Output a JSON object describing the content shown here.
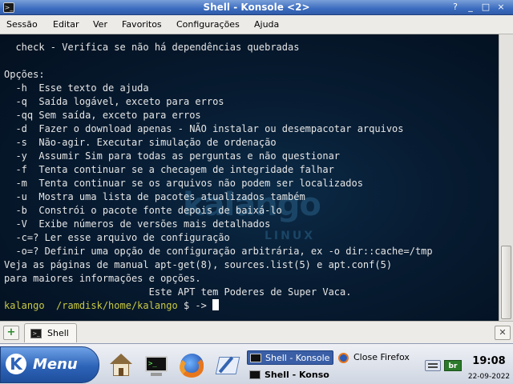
{
  "window": {
    "title": "Shell - Konsole <2>",
    "buttons": [
      "?",
      "_",
      "□",
      "×"
    ]
  },
  "menubar": {
    "items": [
      "Sessão",
      "Editar",
      "Ver",
      "Favoritos",
      "Configurações",
      "Ajuda"
    ]
  },
  "terminal": {
    "watermark": {
      "title": "kalango",
      "subtitle": "LINUX"
    },
    "lines": [
      "  check - Verifica se não há dependências quebradas",
      "",
      "Opções:",
      "  -h  Esse texto de ajuda",
      "  -q  Saída logável, exceto para erros",
      "  -qq Sem saída, exceto para erros",
      "  -d  Fazer o download apenas - NÃO instalar ou desempacotar arquivos",
      "  -s  Não-agir. Executar simulação de ordenação",
      "  -y  Assumir Sim para todas as perguntas e não questionar",
      "  -f  Tenta continuar se a checagem de integridade falhar",
      "  -m  Tenta continuar se os arquivos não podem ser localizados",
      "  -u  Mostra uma lista de pacotes atualizados também",
      "  -b  Constrói o pacote fonte depois de baixá-lo",
      "  -V  Exibe números de versões mais detalhados",
      "  -c=? Ler esse arquivo de configuração",
      "  -o=? Definir uma opção de configuração arbitrária, ex -o dir::cache=/tmp",
      "Veja as páginas de manual apt-get(8), sources.list(5) e apt.conf(5)",
      "para maiores informações e opções.",
      "                         Este APT tem Poderes de Super Vaca."
    ],
    "prompt": {
      "user": "kalango",
      "path": "/ramdisk/home/kalango",
      "symbol": "$ ->"
    }
  },
  "tabbar": {
    "new_tab": "+",
    "tabs": [
      {
        "label": "Shell"
      }
    ],
    "close_tab": "✕"
  },
  "taskbar": {
    "menu_label": "Menu",
    "quick_launch": [
      "home-icon",
      "terminal-icon",
      "firefox-icon",
      "kwrite-icon"
    ],
    "tasks": [
      "Shell - Konsole",
      "Close Firefox",
      "Shell - Konso"
    ],
    "tray": {
      "lang": "br"
    },
    "clock": "19:08",
    "date": "22-09-2022"
  }
}
